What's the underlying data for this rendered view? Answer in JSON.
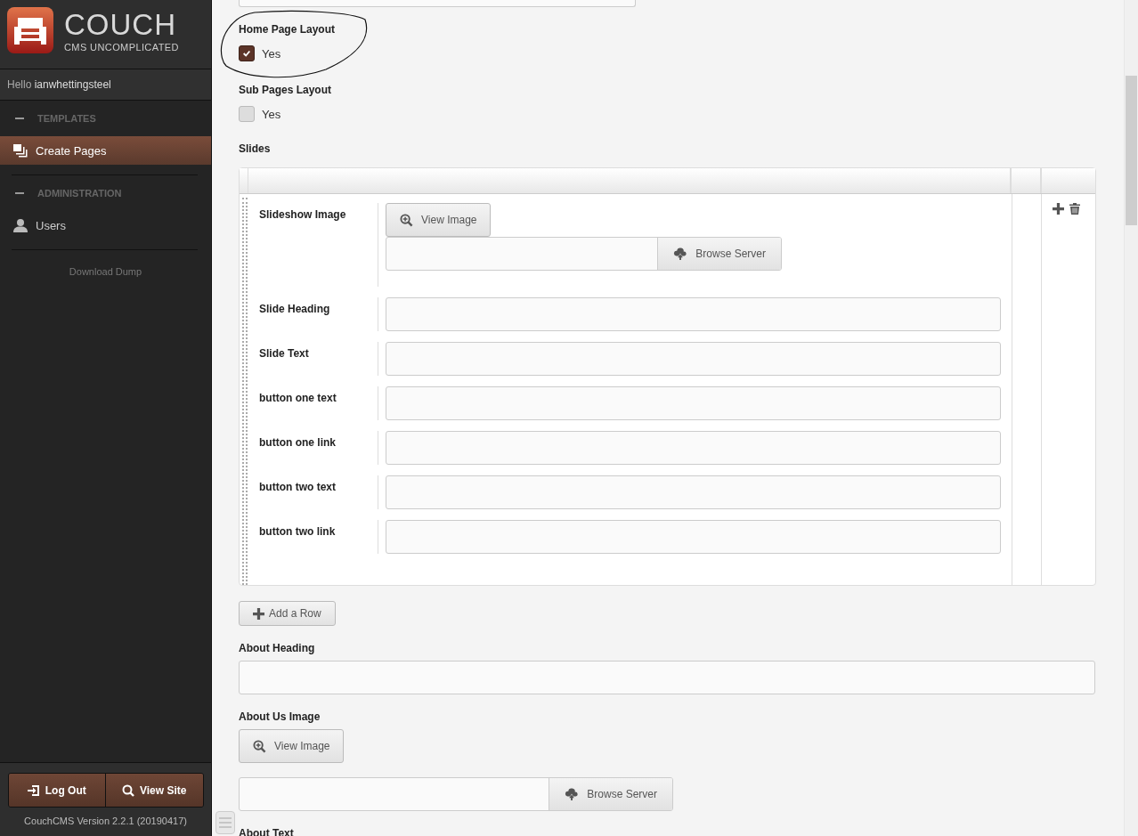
{
  "sidebar": {
    "logo": {
      "title": "COUCH",
      "subtitle": "CMS UNCOMPLICATED"
    },
    "greeting": {
      "prefix": "Hello",
      "user": "ianwhettingsteel"
    },
    "sections": [
      {
        "title": "TEMPLATES",
        "items": [
          {
            "label": "Create Pages",
            "selected": true
          }
        ]
      },
      {
        "title": "ADMINISTRATION",
        "items": [
          {
            "label": "Users",
            "selected": false
          }
        ]
      }
    ],
    "link": "Download Dump",
    "buttons": [
      "Log Out",
      "View Site"
    ],
    "version": "CouchCMS Version 2.2.1 (20190417)"
  },
  "main": {
    "fields": [
      {
        "kind": "cut"
      },
      {
        "kind": "checkbox",
        "label": "Home Page Layout",
        "option": "Yes",
        "checked": true,
        "annotated": true
      },
      {
        "kind": "checkbox",
        "label": "Sub Pages Layout",
        "option": "Yes",
        "checked": false
      },
      {
        "kind": "repeatable",
        "label": "Slides",
        "rows": [
          {
            "fields": [
              {
                "kind": "image",
                "label": "Slideshow Image",
                "view": "View Image",
                "browse": "Browse Server"
              },
              {
                "kind": "text",
                "label": "Slide Heading"
              },
              {
                "kind": "text",
                "label": "Slide Text"
              },
              {
                "kind": "text",
                "label": "button one text"
              },
              {
                "kind": "text",
                "label": "button one link"
              },
              {
                "kind": "text",
                "label": "button two text"
              },
              {
                "kind": "text",
                "label": "button two link"
              }
            ]
          }
        ],
        "add_row": "Add a Row"
      },
      {
        "kind": "text",
        "label": "About Heading"
      },
      {
        "kind": "image",
        "label": "About Us Image",
        "view": "View Image",
        "browse": "Browse Server"
      },
      {
        "kind": "label",
        "label": "About Text"
      }
    ]
  }
}
